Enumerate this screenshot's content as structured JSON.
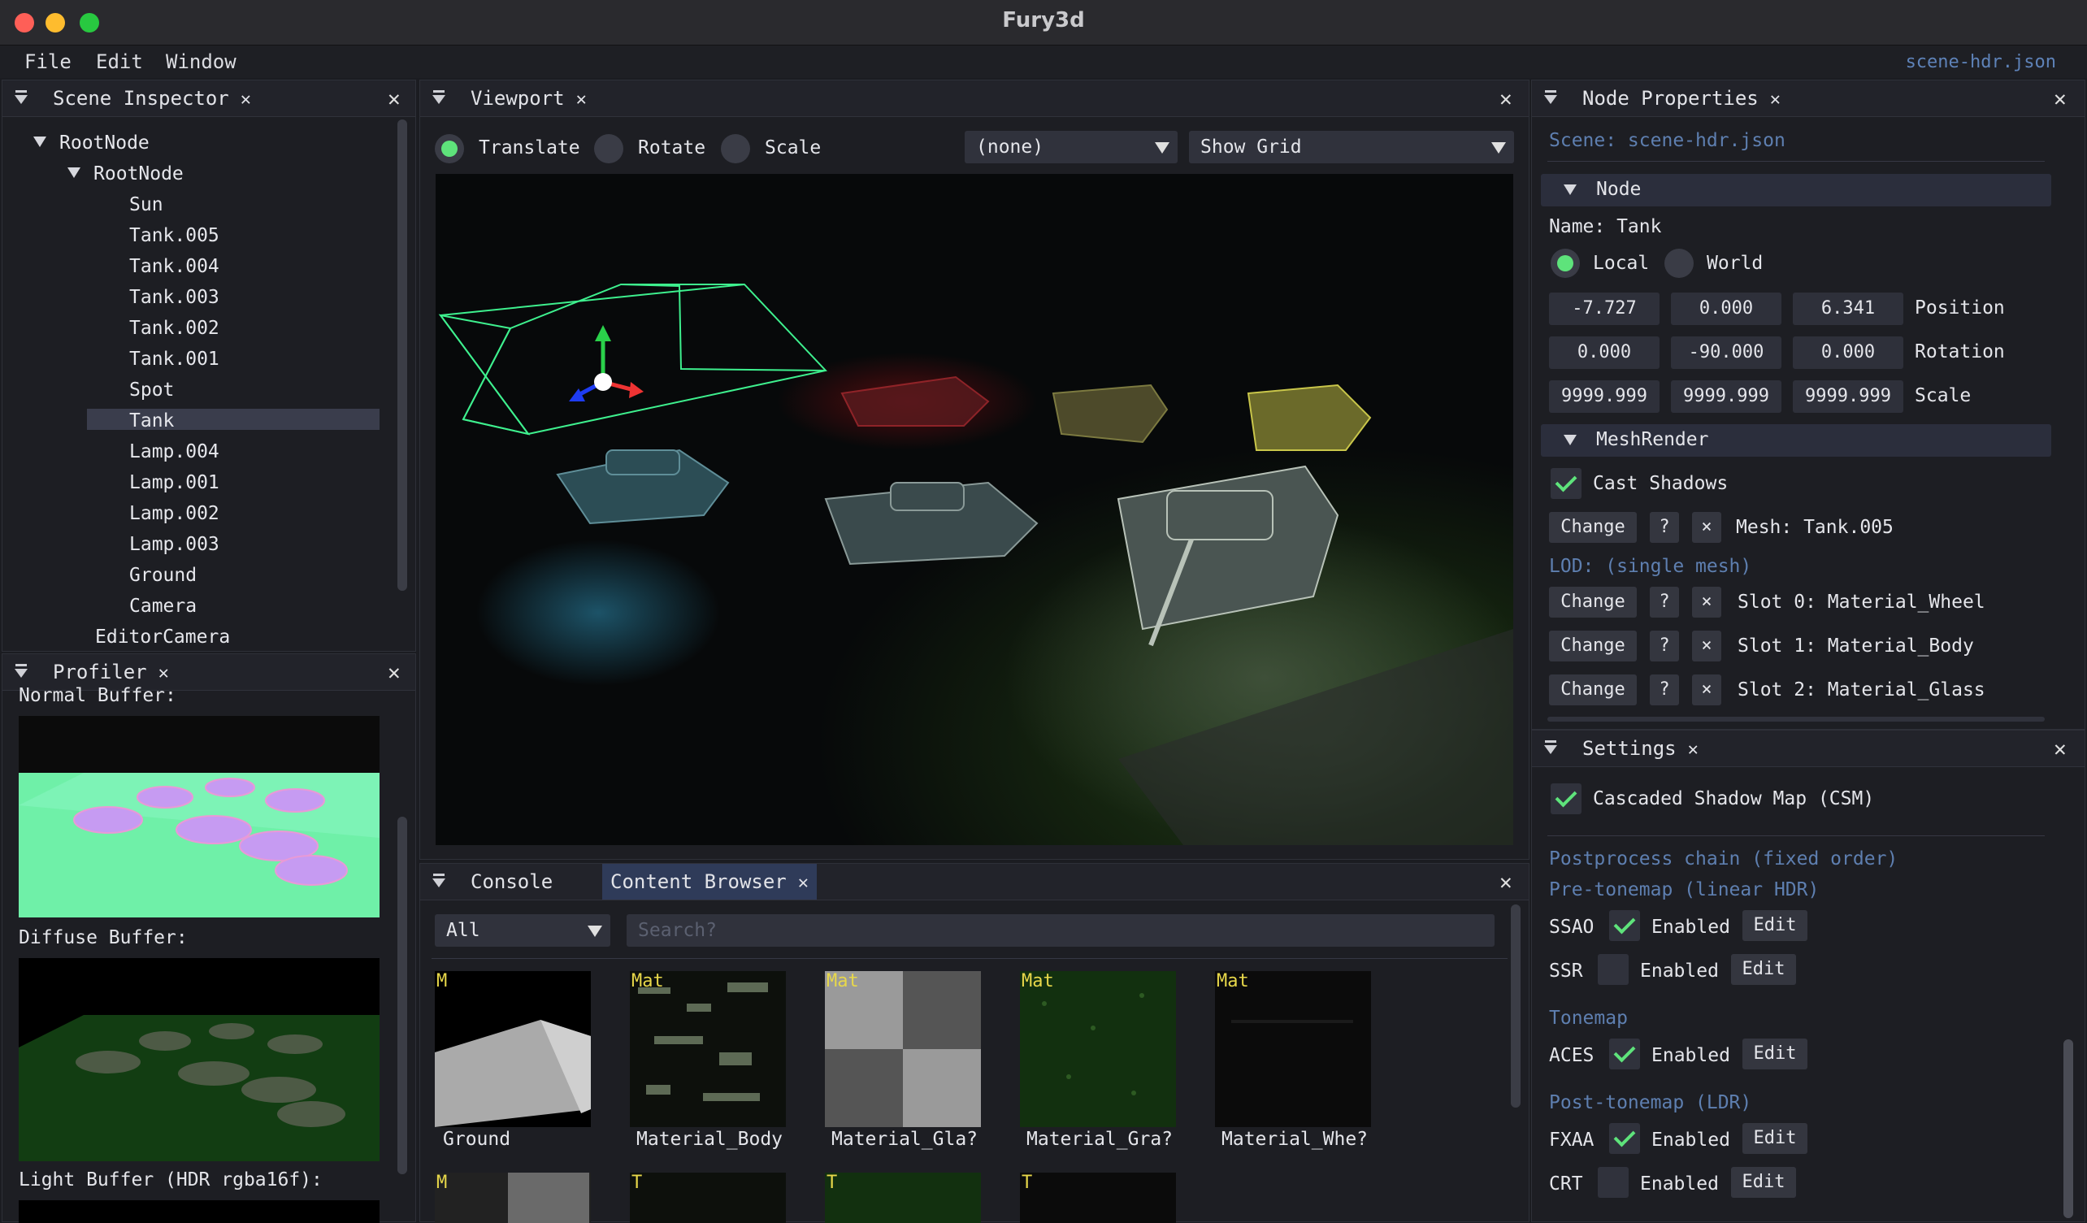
{
  "window": {
    "title": "Fury3d"
  },
  "menu": {
    "items": [
      "File",
      "Edit",
      "Window"
    ],
    "current_file": "scene-hdr.json"
  },
  "scene_inspector": {
    "tab": "Scene Inspector",
    "close": "✕",
    "tree": [
      {
        "label": "RootNode",
        "depth": 0,
        "expanded": true
      },
      {
        "label": "RootNode",
        "depth": 1,
        "expanded": true
      },
      {
        "label": "Sun",
        "depth": 2
      },
      {
        "label": "Tank.005",
        "depth": 2
      },
      {
        "label": "Tank.004",
        "depth": 2
      },
      {
        "label": "Tank.003",
        "depth": 2
      },
      {
        "label": "Tank.002",
        "depth": 2
      },
      {
        "label": "Tank.001",
        "depth": 2
      },
      {
        "label": "Spot",
        "depth": 2
      },
      {
        "label": "Tank",
        "depth": 2,
        "selected": true
      },
      {
        "label": "Lamp.004",
        "depth": 2
      },
      {
        "label": "Lamp.001",
        "depth": 2
      },
      {
        "label": "Lamp.002",
        "depth": 2
      },
      {
        "label": "Lamp.003",
        "depth": 2
      },
      {
        "label": "Ground",
        "depth": 2
      },
      {
        "label": "Camera",
        "depth": 2
      },
      {
        "label": "EditorCamera",
        "depth": 1
      }
    ]
  },
  "profiler": {
    "tab": "Profiler",
    "normal_label": "Normal Buffer:",
    "diffuse_label": "Diffuse Buffer:",
    "light_label": "Light Buffer (HDR rgba16f):"
  },
  "viewport": {
    "tab": "Viewport",
    "modes": [
      {
        "label": "Translate",
        "selected": true
      },
      {
        "label": "Rotate",
        "selected": false
      },
      {
        "label": "Scale",
        "selected": false
      }
    ],
    "combo_a": "(none)",
    "combo_b": "Show Grid"
  },
  "bottom": {
    "tab_console": "Console",
    "tab_content": "Content Browser",
    "filter": "All",
    "search_placeholder": "Search?",
    "assets": [
      {
        "tag": "M",
        "name": "Ground"
      },
      {
        "tag": "Mat",
        "name": "Material_Body"
      },
      {
        "tag": "Mat",
        "name": "Material_Gla?"
      },
      {
        "tag": "Mat",
        "name": "Material_Gra?"
      },
      {
        "tag": "Mat",
        "name": "Material_Whe?"
      }
    ],
    "assets_row2_tags": [
      "M",
      "T",
      "T",
      "T"
    ]
  },
  "node_properties": {
    "tab": "Node Properties",
    "scene_label": "Scene: scene-hdr.json",
    "node_section": "Node",
    "name_label": "Name: Tank",
    "space": {
      "local": "Local",
      "world": "World",
      "selected": "Local"
    },
    "position": {
      "values": [
        "-7.727",
        "0.000",
        "6.341"
      ],
      "label": "Position"
    },
    "rotation": {
      "values": [
        "0.000",
        "-90.000",
        "0.000"
      ],
      "label": "Rotation"
    },
    "scale": {
      "values": [
        "9999.999",
        "9999.999",
        "9999.999"
      ],
      "label": "Scale"
    },
    "meshrender_section": "MeshRender",
    "cast_shadows": {
      "label": "Cast Shadows",
      "checked": true
    },
    "mesh_row": {
      "change": "Change",
      "help": "?",
      "clear": "×",
      "text": "Mesh: Tank.005"
    },
    "lod_label": "LOD: (single mesh)",
    "slots": [
      {
        "change": "Change",
        "help": "?",
        "clear": "×",
        "text": "Slot 0: Material_Wheel"
      },
      {
        "change": "Change",
        "help": "?",
        "clear": "×",
        "text": "Slot 1: Material_Body"
      },
      {
        "change": "Change",
        "help": "?",
        "clear": "×",
        "text": "Slot 2: Material_Glass"
      }
    ]
  },
  "settings": {
    "tab": "Settings",
    "csm": {
      "label": "Cascaded Shadow Map (CSM)",
      "checked": true
    },
    "postprocess_label": "Postprocess chain (fixed order)",
    "pre_tonemap_label": "Pre-tonemap (linear HDR)",
    "tonemap_label": "Tonemap",
    "post_tonemap_label": "Post-tonemap (LDR)",
    "enabled_label": "Enabled",
    "edit_label": "Edit",
    "effects": [
      {
        "name": "SSAO",
        "enabled": true
      },
      {
        "name": "SSR",
        "enabled": false
      },
      {
        "name": "ACES",
        "enabled": true
      },
      {
        "name": "FXAA",
        "enabled": true
      },
      {
        "name": "CRT",
        "enabled": false
      }
    ]
  },
  "colors": {
    "accent_green": "#5ee37b",
    "dim_blue": "#5e7fb0",
    "selection": "#3a3d4c",
    "active_tab": "#2f3b59"
  }
}
